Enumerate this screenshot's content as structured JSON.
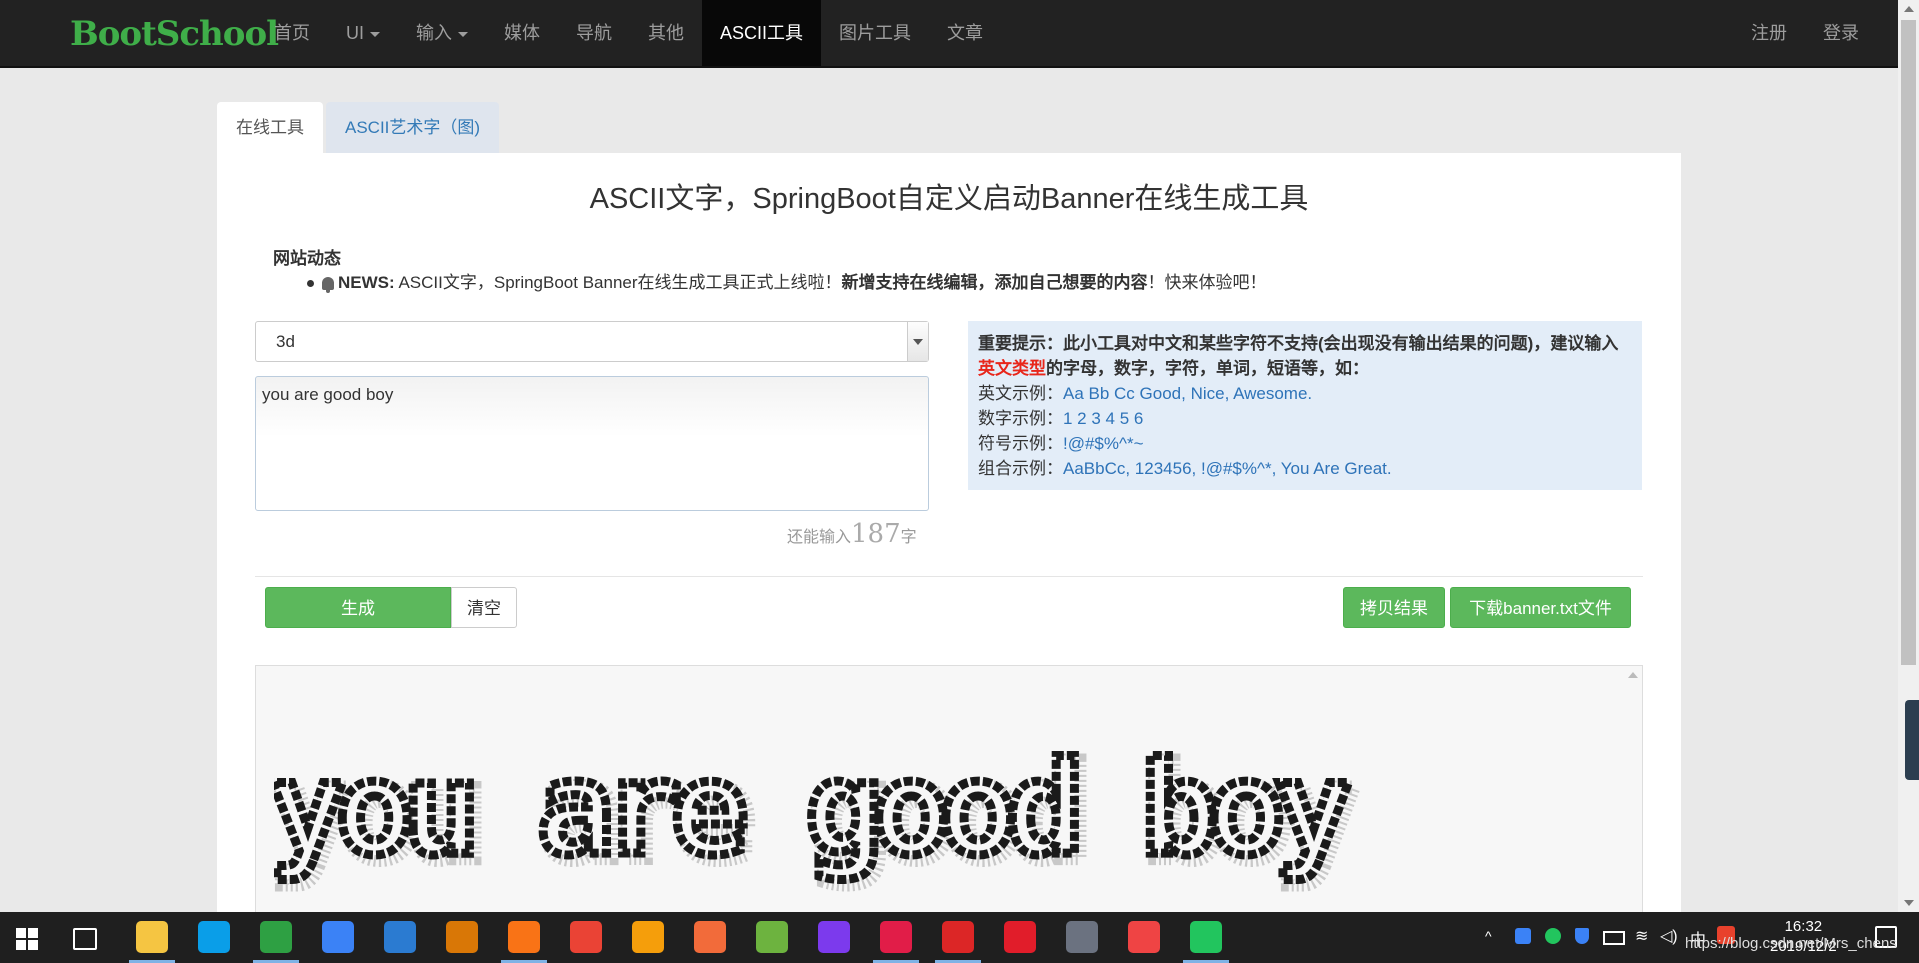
{
  "nav": {
    "brand": "BootSchool",
    "items": [
      {
        "label": "首页",
        "dropdown": false,
        "active": false
      },
      {
        "label": "UI",
        "dropdown": true,
        "active": false
      },
      {
        "label": "输入",
        "dropdown": true,
        "active": false
      },
      {
        "label": "媒体",
        "dropdown": false,
        "active": false
      },
      {
        "label": "导航",
        "dropdown": false,
        "active": false
      },
      {
        "label": "其他",
        "dropdown": false,
        "active": false
      },
      {
        "label": "ASCII工具",
        "dropdown": false,
        "active": true
      },
      {
        "label": "图片工具",
        "dropdown": false,
        "active": false
      },
      {
        "label": "文章",
        "dropdown": false,
        "active": false
      }
    ],
    "register": "注册",
    "login": "登录"
  },
  "tabs": [
    {
      "label": "在线工具",
      "active": true
    },
    {
      "label": "ASCII艺术字（图)",
      "active": false
    }
  ],
  "page": {
    "title": "ASCII文字，SpringBoot自定义启动Banner在线生成工具",
    "news_heading": "网站动态",
    "news_label": "NEWS:",
    "news_text1": "ASCII文字，SpringBoot Banner在线生成工具正式上线啦！",
    "news_bold": "新增支持在线编辑，添加自己想要的内容",
    "news_text2": "！快来体验吧！"
  },
  "form": {
    "font_selected": "3d",
    "input_text": "you are good boy",
    "counter_prefix": "还能输入",
    "counter_value": "187",
    "counter_suffix": "字"
  },
  "tip": {
    "line1_bold": "重要提示：此小工具对中文和某些字符不支持(会出现没有输出结果的问题)，建议输入",
    "highlight": "英文类型",
    "line2_bold": "的字母，数字，字符，单词，短语等，如：",
    "examples": [
      {
        "label": "英文示例：",
        "value": "Aa Bb Cc Good, Nice, Awesome."
      },
      {
        "label": "数字示例：",
        "value": "1 2 3 4 5 6"
      },
      {
        "label": "符号示例：",
        "value": "!@#$%^*~"
      },
      {
        "label": "组合示例：",
        "value": "AaBbCc, 123456, !@#$%^*, You Are Great."
      }
    ]
  },
  "buttons": {
    "generate": "生成",
    "clear": "清空",
    "copy": "拷贝结果",
    "download": "下载banner.txt文件"
  },
  "output": {
    "text": "you are good boy"
  },
  "taskbar": {
    "time": "16:32",
    "date": "2019/12/2",
    "ime": "中",
    "watermark": "https://blog.csdn.net/Mrs_chens",
    "apps": [
      "file-explorer-icon",
      "skype-icon",
      "hbuilder-icon",
      "notes-icon",
      "vscode-icon",
      "colors-icon",
      "firefox-icon",
      "chrome-icon",
      "search-tool-icon",
      "postman-icon",
      "spring-icon",
      "axure-icon",
      "intellij-icon",
      "youdao-icon",
      "netease-music-icon",
      "github-icon",
      "snail-icon",
      "wechat-icon"
    ]
  },
  "colors": {
    "accent_green": "#5cb85c",
    "brand_green": "#3fae49",
    "link_blue": "#337ab7",
    "tip_bg": "#e3edf8",
    "highlight_red": "#e8261b"
  }
}
